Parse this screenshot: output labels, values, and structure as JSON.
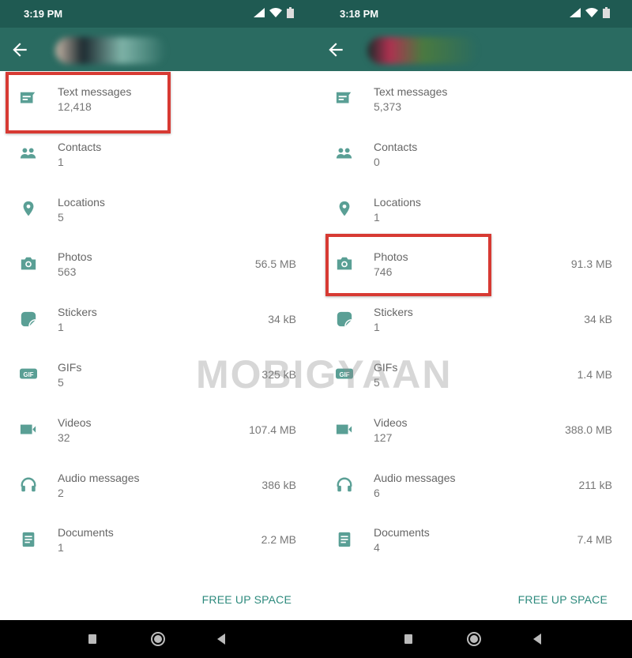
{
  "colors": {
    "statusbar": "#1f5a52",
    "appbar": "#2a6b61",
    "icon": "#5a9f95",
    "accent": "#2d8a7d",
    "highlight": "#d73a33"
  },
  "watermark": "MOBIGYAAN",
  "free_up_label": "FREE UP SPACE",
  "left": {
    "time": "3:19 PM",
    "items": [
      {
        "icon": "message-icon",
        "label": "Text messages",
        "count": "12,418",
        "size": ""
      },
      {
        "icon": "contacts-icon",
        "label": "Contacts",
        "count": "1",
        "size": ""
      },
      {
        "icon": "location-icon",
        "label": "Locations",
        "count": "5",
        "size": ""
      },
      {
        "icon": "camera-icon",
        "label": "Photos",
        "count": "563",
        "size": "56.5 MB"
      },
      {
        "icon": "sticker-icon",
        "label": "Stickers",
        "count": "1",
        "size": "34 kB"
      },
      {
        "icon": "gif-icon",
        "label": "GIFs",
        "count": "5",
        "size": "325 kB"
      },
      {
        "icon": "video-icon",
        "label": "Videos",
        "count": "32",
        "size": "107.4 MB"
      },
      {
        "icon": "headphones-icon",
        "label": "Audio messages",
        "count": "2",
        "size": "386 kB"
      },
      {
        "icon": "document-icon",
        "label": "Documents",
        "count": "1",
        "size": "2.2 MB"
      }
    ]
  },
  "right": {
    "time": "3:18 PM",
    "items": [
      {
        "icon": "message-icon",
        "label": "Text messages",
        "count": "5,373",
        "size": ""
      },
      {
        "icon": "contacts-icon",
        "label": "Contacts",
        "count": "0",
        "size": ""
      },
      {
        "icon": "location-icon",
        "label": "Locations",
        "count": "1",
        "size": ""
      },
      {
        "icon": "camera-icon",
        "label": "Photos",
        "count": "746",
        "size": "91.3 MB"
      },
      {
        "icon": "sticker-icon",
        "label": "Stickers",
        "count": "1",
        "size": "34 kB"
      },
      {
        "icon": "gif-icon",
        "label": "GIFs",
        "count": "5",
        "size": "1.4 MB"
      },
      {
        "icon": "video-icon",
        "label": "Videos",
        "count": "127",
        "size": "388.0 MB"
      },
      {
        "icon": "headphones-icon",
        "label": "Audio messages",
        "count": "6",
        "size": "211 kB"
      },
      {
        "icon": "document-icon",
        "label": "Documents",
        "count": "4",
        "size": "7.4 MB"
      }
    ]
  }
}
